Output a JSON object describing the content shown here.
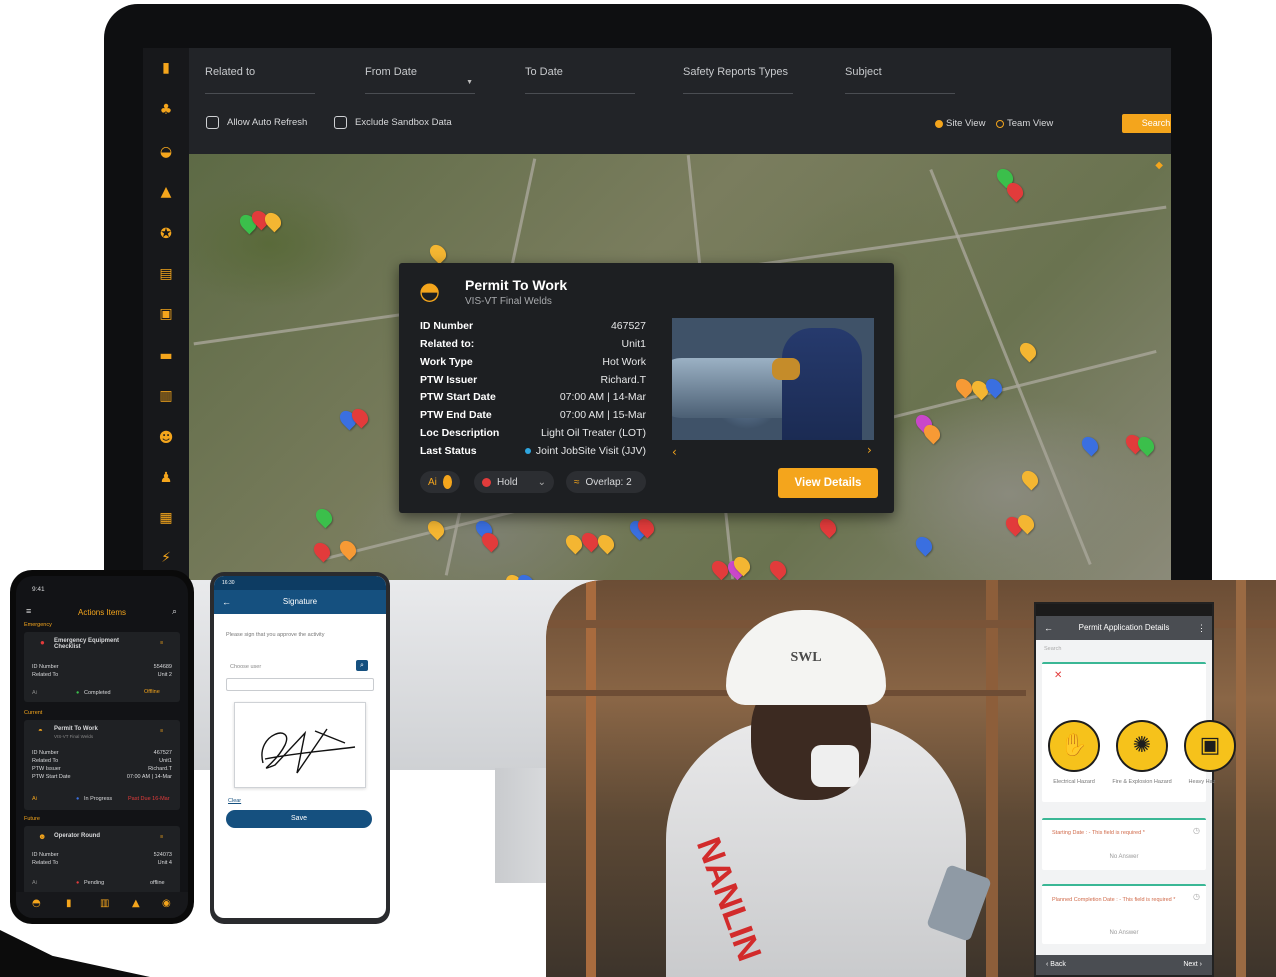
{
  "filters": {
    "related_to": "Related to",
    "from_date": "From Date",
    "to_date": "To Date",
    "safety_reports_types": "Safety Reports Types",
    "subject": "Subject",
    "allow_auto_refresh": "Allow Auto Refresh",
    "exclude_sandbox": "Exclude Sandbox Data",
    "site_view": "Site View",
    "team_view": "Team View",
    "search": "Search"
  },
  "popup": {
    "title": "Permit To Work",
    "subtitle": "VIS-VT Final Welds",
    "rows": [
      {
        "k": "ID Number",
        "v": "467527"
      },
      {
        "k": "Related to:",
        "v": "Unit1"
      },
      {
        "k": "Work Type",
        "v": "Hot Work"
      },
      {
        "k": "PTW Issuer",
        "v": "Richard.T"
      },
      {
        "k": "PTW Start Date",
        "v": "07:00 AM | 14-Mar"
      },
      {
        "k": "PTW End Date",
        "v": "07:00 AM | 15-Mar"
      },
      {
        "k": "Loc Description",
        "v": "Light Oil Treater (LOT)"
      },
      {
        "k": "Last Status",
        "v": "Joint JobSite Visit (JJV)"
      }
    ],
    "ai_label": "Ai",
    "hold_label": "Hold",
    "overlap_label": "Overlap: 2",
    "view_details": "View Details"
  },
  "phone1": {
    "time": "9:41",
    "title": "Actions Items",
    "section_emergency": "Emergency",
    "card1_title": "Emergency Equipment Checklist",
    "card1_id_label": "ID Number",
    "card1_id": "554689",
    "card1_related_label": "Related To",
    "card1_related": "Unit 2",
    "card1_status": "Completed",
    "card1_offline": "Offline",
    "section_current": "Current",
    "card2_title": "Permit To Work",
    "card2_sub": "VIS-VT Final Welds",
    "card2_id_label": "ID Number",
    "card2_id": "467527",
    "card2_related_label": "Related To",
    "card2_related": "Unit1",
    "card2_issuer_label": "PTW Issuer",
    "card2_issuer": "Richard.T",
    "card2_start_label": "PTW Start Date",
    "card2_start": "07:00 AM | 14-Mar",
    "card2_status": "In Progress",
    "card2_due": "Past Due 16-Mar",
    "section_future": "Future",
    "card3_title": "Operator Round",
    "card3_id_label": "ID Number",
    "card3_id": "524073",
    "card3_related_label": "Related To",
    "card3_related": "Unit 4",
    "card3_status": "Pending",
    "card3_offline": "offline",
    "ai_label": "Ai"
  },
  "phone2": {
    "status": "16:30",
    "title": "Signature",
    "instruction": "Please sign that you approve the activity",
    "choose_user": "Choose user",
    "clear": "Clear",
    "save": "Save"
  },
  "phone3": {
    "title": "Permit Application Details",
    "search": "Search",
    "hazard1": "Electrical Hazard",
    "hazard2": "Fire & Explosion Hazard",
    "hazard3": "Heavy Haz",
    "starting_date": "Starting Date : - This field is required *",
    "no_answer_1": "No Answer",
    "planned_completion": "Planned Completion Date : - This field is required *",
    "no_answer_2": "No Answer",
    "back": "Back",
    "next": "Next"
  },
  "photo": {
    "helmet_text": "SWL",
    "vest_text": "NANLIN"
  },
  "colors": {
    "accent": "#f4a51c",
    "dark": "#1d1f22",
    "blue": "#15507f"
  }
}
